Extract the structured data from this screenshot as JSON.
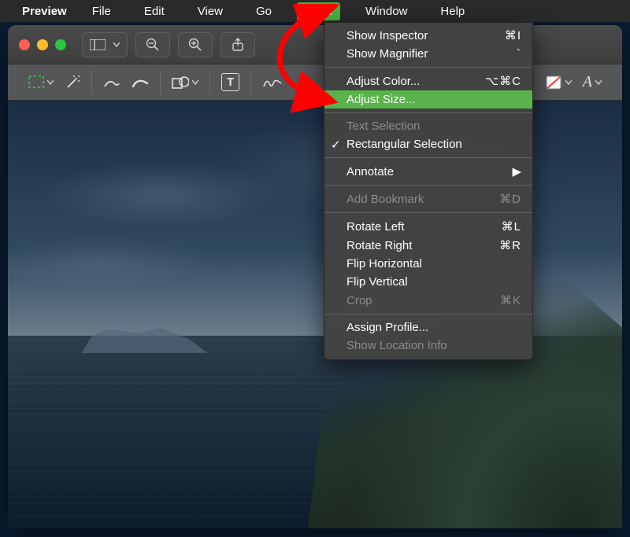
{
  "menubar": {
    "app_name": "Preview",
    "items": [
      "File",
      "Edit",
      "View",
      "Go",
      "Tools",
      "Window",
      "Help"
    ],
    "active_index": 4
  },
  "tools_menu": {
    "groups": [
      [
        {
          "label": "Show Inspector",
          "shortcut": "⌘I",
          "disabled": false
        },
        {
          "label": "Show Magnifier",
          "shortcut": "`",
          "disabled": false
        }
      ],
      [
        {
          "label": "Adjust Color...",
          "shortcut": "⌥⌘C",
          "disabled": false
        },
        {
          "label": "Adjust Size...",
          "shortcut": "",
          "disabled": false,
          "highlight": true
        }
      ],
      [
        {
          "label": "Text Selection",
          "shortcut": "",
          "disabled": true
        },
        {
          "label": "Rectangular Selection",
          "shortcut": "",
          "disabled": false,
          "checked": true
        }
      ],
      [
        {
          "label": "Annotate",
          "shortcut": "",
          "disabled": false,
          "submenu": true
        }
      ],
      [
        {
          "label": "Add Bookmark",
          "shortcut": "⌘D",
          "disabled": true
        }
      ],
      [
        {
          "label": "Rotate Left",
          "shortcut": "⌘L",
          "disabled": false
        },
        {
          "label": "Rotate Right",
          "shortcut": "⌘R",
          "disabled": false
        },
        {
          "label": "Flip Horizontal",
          "shortcut": "",
          "disabled": false
        },
        {
          "label": "Flip Vertical",
          "shortcut": "",
          "disabled": false
        },
        {
          "label": "Crop",
          "shortcut": "⌘K",
          "disabled": true
        }
      ],
      [
        {
          "label": "Assign Profile...",
          "shortcut": "",
          "disabled": false
        },
        {
          "label": "Show Location Info",
          "shortcut": "",
          "disabled": true
        }
      ]
    ]
  },
  "colors": {
    "highlight_green": "#4bb03e",
    "annotation_red": "#ff0000"
  }
}
